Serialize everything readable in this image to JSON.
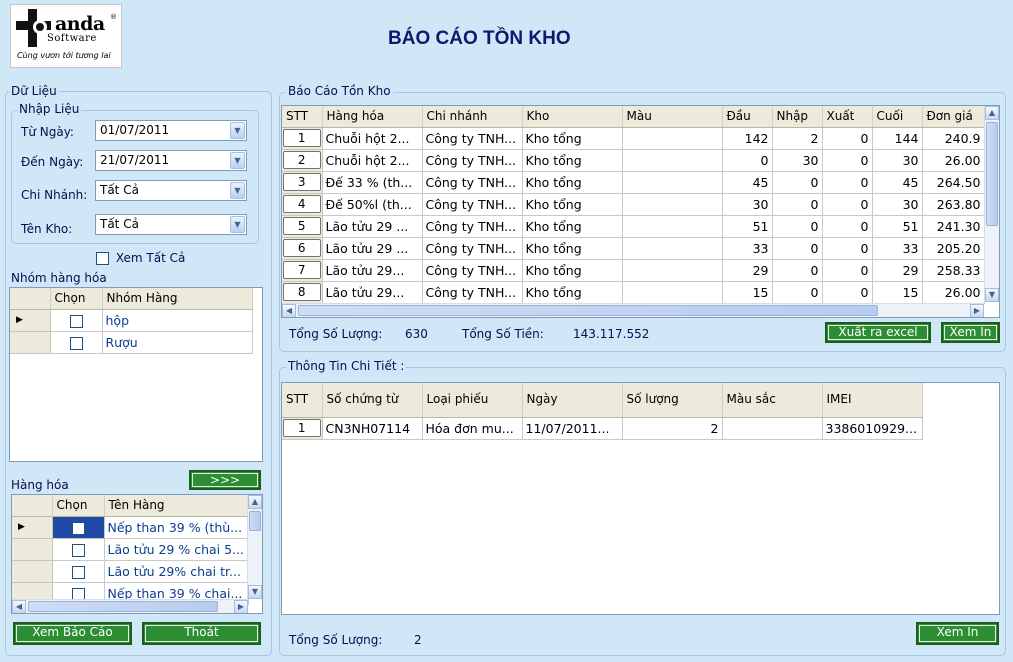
{
  "logo": {
    "name": "anda",
    "sub": "Software",
    "tagline": "Cùng vươn tới tương lai",
    "reg": "®"
  },
  "title": "BÁO CÁO TỒN KHO",
  "left": {
    "data_group": "Dữ Liệu",
    "input_group": "Nhập Liệu",
    "from_label": "Từ Ngày:",
    "from_value": "01/07/2011",
    "to_label": "Đến Ngày:",
    "to_value": "21/07/2011",
    "branch_label": "Chi Nhánh:",
    "branch_value": "Tất Cả",
    "store_label": "Tên Kho:",
    "store_value": "Tất Cả",
    "show_all": "Xem Tất Cả",
    "group_title": "Nhóm hàng hóa",
    "group_cols": [
      "Chọn",
      "Nhóm Hàng"
    ],
    "groups": [
      "hộp",
      "Rượu"
    ],
    "move_button": ">>>",
    "goods_title": "Hàng hóa",
    "goods_cols": [
      "Chọn",
      "Tên Hàng"
    ],
    "goods": [
      "Nếp than 39 % (thù...",
      "Lão tửu 29 % chai 5...",
      "Lão tửu 29% chai tr...",
      "Nếp than 39 % chai..."
    ],
    "view_report": "Xem Báo Cáo",
    "exit": "Thoát"
  },
  "report": {
    "title": "Báo Cáo Tồn Kho",
    "columns": [
      "STT",
      "Hàng hóa",
      "Chi nhánh",
      "Kho",
      "Màu",
      "Đầu",
      "Nhập",
      "Xuất",
      "Cuối",
      "Đơn giá"
    ],
    "rows": [
      [
        "1",
        "Chuỗi hột 2...",
        "Công ty TNH...",
        "Kho tổng",
        "",
        "142",
        "2",
        "0",
        "144",
        "240.9"
      ],
      [
        "2",
        "Chuỗi hột 2...",
        "Công ty TNH...",
        "Kho tổng",
        "",
        "0",
        "30",
        "0",
        "30",
        "26.00"
      ],
      [
        "3",
        "Đế 33 % (th...",
        "Công ty TNH...",
        "Kho tổng",
        "",
        "45",
        "0",
        "0",
        "45",
        "264.50"
      ],
      [
        "4",
        "Đế 50%l (th...",
        "Công ty TNH...",
        "Kho tổng",
        "",
        "30",
        "0",
        "0",
        "30",
        "263.80"
      ],
      [
        "5",
        "Lão tửu 29 ...",
        "Công ty TNH...",
        "Kho tổng",
        "",
        "51",
        "0",
        "0",
        "51",
        "241.30"
      ],
      [
        "6",
        "Lão tửu 29 ...",
        "Công ty TNH...",
        "Kho tổng",
        "",
        "33",
        "0",
        "0",
        "33",
        "205.20"
      ],
      [
        "7",
        "Lão tửu 29...",
        "Công ty TNH...",
        "Kho tổng",
        "",
        "29",
        "0",
        "0",
        "29",
        "258.33"
      ],
      [
        "8",
        "Lão tửu 29...",
        "Công ty TNH...",
        "Kho tổng",
        "",
        "15",
        "0",
        "0",
        "15",
        "26.00"
      ]
    ],
    "total_qty_label": "Tổng Số Lượng:",
    "total_qty": "630",
    "total_money_label": "Tổng Số Tiền:",
    "total_money": "143.117.552",
    "export_excel": "Xuất ra excel",
    "print": "Xem  In"
  },
  "detail": {
    "title": "Thông Tin Chi Tiết :",
    "columns": [
      "STT",
      "Số chứng từ",
      "Loại phiếu",
      "Ngày",
      "Số lượng",
      "Màu sắc",
      "IMEI"
    ],
    "rows": [
      [
        "1",
        "CN3NH07114",
        "Hóa đơn mu...",
        "11/07/2011...",
        "2",
        "",
        "3386010929..."
      ]
    ],
    "total_qty_label": "Tổng Số Lượng:",
    "total_qty": "2",
    "print": "Xem In"
  }
}
